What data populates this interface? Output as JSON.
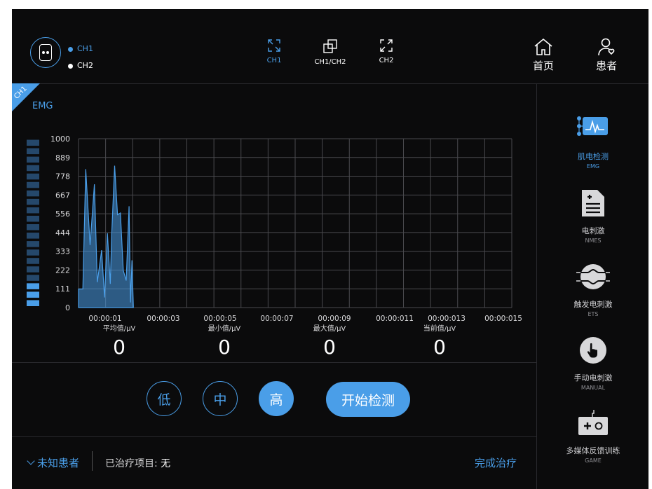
{
  "header": {
    "channels": [
      {
        "label": "CH1",
        "color": "#4a9ee8"
      },
      {
        "label": "CH2",
        "color": "#ffffff"
      }
    ],
    "views": [
      {
        "label": "CH1",
        "active": true
      },
      {
        "label": "CH1/CH2",
        "active": false
      },
      {
        "label": "CH2",
        "active": false
      }
    ],
    "home_label": "首页",
    "patient_label": "患者"
  },
  "panel": {
    "channel_tag": "CH1",
    "signal_label": "EMG"
  },
  "chart_data": {
    "type": "area",
    "y_ticks": [
      "1000",
      "889",
      "778",
      "667",
      "556",
      "444",
      "333",
      "222",
      "111",
      "0"
    ],
    "x_ticks": [
      "00:00:01",
      "00:00:03",
      "00:00:05",
      "00:00:07",
      "00:00:09",
      "00:00:011",
      "00:00:013",
      "00:00:015"
    ],
    "ylim": [
      0,
      1000
    ],
    "xlim": [
      0,
      15
    ],
    "grid": true,
    "series": [
      {
        "color": "#4a9ee8",
        "x": [
          0,
          0.15,
          0.25,
          0.4,
          0.55,
          0.65,
          0.8,
          0.9,
          1.0,
          1.1,
          1.15,
          1.25,
          1.35,
          1.45,
          1.55,
          1.65,
          1.75,
          1.8,
          1.85,
          1.9
        ],
        "y": [
          110,
          110,
          820,
          370,
          730,
          150,
          340,
          60,
          440,
          140,
          440,
          840,
          550,
          560,
          220,
          160,
          600,
          30,
          280,
          0
        ]
      }
    ],
    "level_meter": {
      "segments": 20,
      "lit": 3
    }
  },
  "stats": [
    {
      "label": "平均值/μV",
      "value": "0"
    },
    {
      "label": "最小值/μV",
      "value": "0"
    },
    {
      "label": "最大值/μV",
      "value": "0"
    },
    {
      "label": "当前值/μV",
      "value": "0"
    }
  ],
  "controls": {
    "levels": [
      {
        "label": "低",
        "active": false
      },
      {
        "label": "中",
        "active": false
      },
      {
        "label": "高",
        "active": true
      }
    ],
    "start_label": "开始检测"
  },
  "footer": {
    "patient": "未知患者",
    "treatment_label": "已治疗项目:",
    "treatment_value": "无",
    "finish_label": "完成治疗"
  },
  "sidebar": {
    "items": [
      {
        "title": "肌电检测",
        "subtitle": "EMG",
        "icon": "emg-waveform-icon",
        "active": true
      },
      {
        "title": "电刺激",
        "subtitle": "NMES",
        "icon": "document-plus-icon",
        "active": false
      },
      {
        "title": "触发电刺激",
        "subtitle": "ETS",
        "icon": "trigger-wave-icon",
        "active": false
      },
      {
        "title": "手动电刺激",
        "subtitle": "MANUAL",
        "icon": "hand-pointer-icon",
        "active": false
      },
      {
        "title": "多媒体反馈训练",
        "subtitle": "GAME",
        "icon": "gamepad-icon",
        "active": false
      }
    ]
  }
}
